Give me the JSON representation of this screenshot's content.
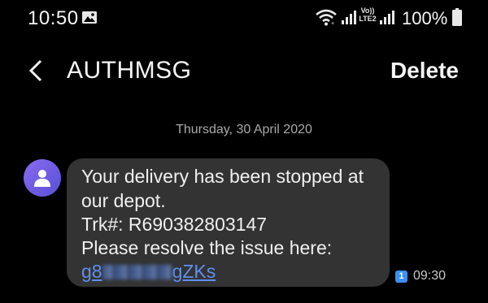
{
  "status_bar": {
    "time": "10:50",
    "network_label": "Vo)) LTE2",
    "battery_percent": "100%",
    "icons": [
      "gallery-icon",
      "wifi-icon",
      "signal-icon",
      "signal-icon",
      "battery-icon"
    ]
  },
  "header": {
    "back_icon": "chevron-left-icon",
    "title": "AUTHMSG",
    "delete_label": "Delete"
  },
  "conversation": {
    "date_separator": "Thursday, 30 April 2020",
    "message": {
      "lines": [
        "Your delivery has been stopped at",
        "our depot.",
        "Trk#: R690382803147",
        "Please resolve the issue here:"
      ],
      "link_start": "g8",
      "link_end": "gZKs",
      "sim": "1",
      "time": "09:30"
    }
  },
  "colors": {
    "background": "#000000",
    "bubble": "#333333",
    "link": "#5f8ff0",
    "avatar": "#7a63e8",
    "sim_badge": "#3d8ff0"
  }
}
